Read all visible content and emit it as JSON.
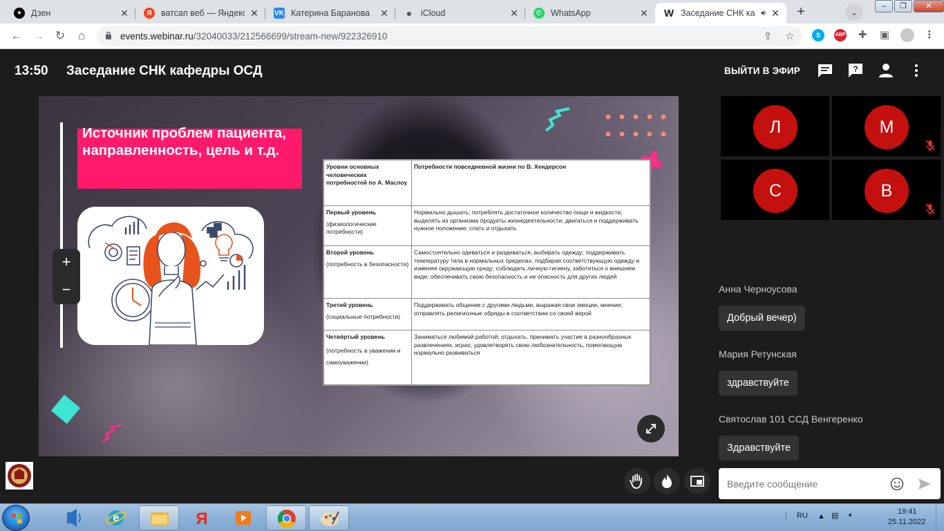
{
  "browser": {
    "tabs": [
      {
        "title": "Дзен",
        "favicon": "dzen-icon",
        "color": "#000000"
      },
      {
        "title": "ватсап веб — Яндекс: н",
        "favicon": "yandex-icon",
        "color": "#fc3f1d"
      },
      {
        "title": "Катерина Баранова",
        "favicon": "vk-icon",
        "color": "#2787f5"
      },
      {
        "title": "iCloud",
        "favicon": "apple-icon",
        "color": "#555555"
      },
      {
        "title": "WhatsApp",
        "favicon": "whatsapp-icon",
        "color": "#25d366"
      },
      {
        "title": "Заседание СНК ка",
        "favicon": "webinar-icon",
        "color": "#222222",
        "active": true
      }
    ],
    "new_tab_label": "+",
    "url_host": "events.webinar.ru",
    "url_path": "/32040033/212566699/stream-new/922326910"
  },
  "header": {
    "time": "13:50",
    "title": "Заседание СНК кафедры ОСД",
    "go_live": "ВЫЙТИ В ЭФИР"
  },
  "slide": {
    "heading": "Источник проблем пациента, направленность, цель и т.д.",
    "zoom_in": "+",
    "zoom_out": "−",
    "table": {
      "header_left": "Уровни основных человеческих потребностей по А. Маслоу",
      "header_right": "Потребности повседневной жизни по В. Хендерсон",
      "rows": [
        {
          "level": "Первый уровень",
          "sub": "(физиологические потребности)",
          "needs": "Нормально дышать; потреблять достаточное количество пищи и жидкости; выделять из организма продукты жизнедеятельности; двигаться и поддерживать нужное положение; спать и отдыхать"
        },
        {
          "level": "Второй уровень",
          "sub": "(потребность в безопасности)",
          "needs": "Самостоятельно одеваться и раздеваться, выбирать одежду; поддерживать температуру тела в нормальных пределах, подбирая соответствующую одежду и изменяя окружающую среду; соблюдать личную гигиену, заботиться о внешнем виде; обеспечивать свою безопасность и не опасность для других людей"
        },
        {
          "level": "Третий уровень",
          "sub": "(социальные потребности)",
          "needs": "Поддерживать общение с другими людьми, выражая свои эмоции, мнение; отправлять религиозные обряды в соответствии со своей верой"
        },
        {
          "level": "Четвёртый уровень",
          "sub": "(потребность в уважении и самоуважении)",
          "needs": "Заниматься любимой работой; отдыхать, принимать участие в разнообразных развлечениях, играх; удовлетворять свою любознательность, помогающую нормально развиваться"
        }
      ]
    }
  },
  "participants": [
    {
      "initial": "Л",
      "muted": false
    },
    {
      "initial": "М",
      "muted": true
    },
    {
      "initial": "С",
      "muted": false
    },
    {
      "initial": "В",
      "muted": true
    }
  ],
  "chat": {
    "messages": [
      {
        "author": "Анна Черноусова",
        "text": "Добрый вечер)"
      },
      {
        "author": "Мария Ретунская",
        "text": "здравствуйте"
      },
      {
        "author": "Святослав 101 ССД Венгеренко",
        "text": "Здравствуйте"
      }
    ],
    "input_placeholder": "Введите сообщение"
  },
  "taskbar": {
    "language": "RU",
    "time": "19:41",
    "date": "25.11.2022"
  },
  "colors": {
    "accent_pink": "#ff1a6c",
    "avatar_red": "#c4100e",
    "background": "#1c1c1c"
  }
}
